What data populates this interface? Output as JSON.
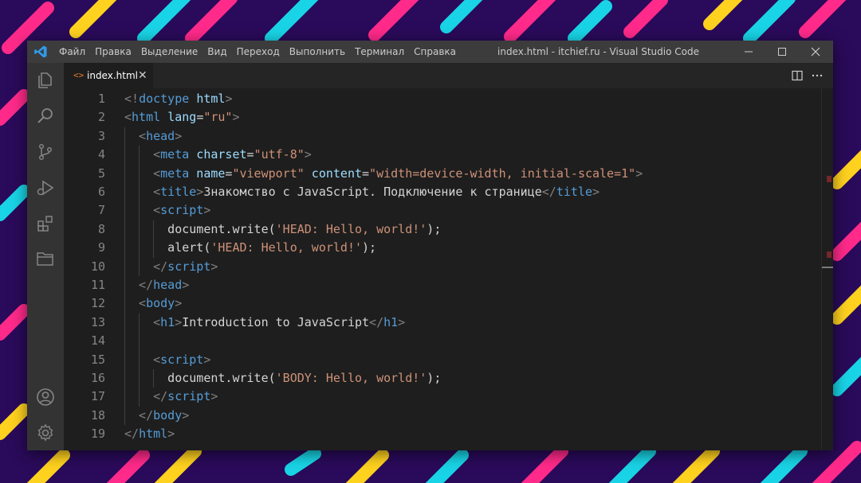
{
  "window": {
    "title": "index.html - itchief.ru - Visual Studio Code",
    "menu": [
      "Файл",
      "Правка",
      "Выделение",
      "Вид",
      "Переход",
      "Выполнить",
      "Терминал",
      "Справка"
    ]
  },
  "activity_bar": [
    "files-icon",
    "search-icon",
    "source-control-icon",
    "run-debug-icon",
    "extensions-icon",
    "remote-explorer-icon",
    "account-icon",
    "settings-gear-icon"
  ],
  "tab": {
    "label": "index.html",
    "icon": "<>",
    "close": "✕"
  },
  "editor": {
    "line_numbers": [
      "1",
      "2",
      "3",
      "4",
      "5",
      "6",
      "7",
      "8",
      "9",
      "10",
      "11",
      "12",
      "13",
      "14",
      "15",
      "16",
      "17",
      "18",
      "19"
    ],
    "lines": [
      {
        "indent": 0,
        "tokens": [
          [
            "tg",
            "<!"
          ],
          [
            "tn",
            "doctype"
          ],
          [
            "tx",
            " "
          ],
          [
            "at",
            "html"
          ],
          [
            "tg",
            ">"
          ]
        ]
      },
      {
        "indent": 0,
        "tokens": [
          [
            "tg",
            "<"
          ],
          [
            "tn",
            "html"
          ],
          [
            "tx",
            " "
          ],
          [
            "at",
            "lang"
          ],
          [
            "tx",
            "="
          ],
          [
            "st",
            "\"ru\""
          ],
          [
            "tg",
            ">"
          ]
        ]
      },
      {
        "indent": 1,
        "tokens": [
          [
            "tg",
            "<"
          ],
          [
            "tn",
            "head"
          ],
          [
            "tg",
            ">"
          ]
        ]
      },
      {
        "indent": 2,
        "tokens": [
          [
            "tg",
            "<"
          ],
          [
            "tn",
            "meta"
          ],
          [
            "tx",
            " "
          ],
          [
            "at",
            "charset"
          ],
          [
            "tx",
            "="
          ],
          [
            "st",
            "\"utf-8\""
          ],
          [
            "tg",
            ">"
          ]
        ]
      },
      {
        "indent": 2,
        "tokens": [
          [
            "tg",
            "<"
          ],
          [
            "tn",
            "meta"
          ],
          [
            "tx",
            " "
          ],
          [
            "at",
            "name"
          ],
          [
            "tx",
            "="
          ],
          [
            "st",
            "\"viewport\""
          ],
          [
            "tx",
            " "
          ],
          [
            "at",
            "content"
          ],
          [
            "tx",
            "="
          ],
          [
            "st",
            "\"width=device-width, initial-scale=1\""
          ],
          [
            "tg",
            ">"
          ]
        ]
      },
      {
        "indent": 2,
        "tokens": [
          [
            "tg",
            "<"
          ],
          [
            "tn",
            "title"
          ],
          [
            "tg",
            ">"
          ],
          [
            "tx",
            "Знакомство с JavaScript. Подключение к странице"
          ],
          [
            "tg",
            "</"
          ],
          [
            "tn",
            "title"
          ],
          [
            "tg",
            ">"
          ]
        ]
      },
      {
        "indent": 2,
        "tokens": [
          [
            "tg",
            "<"
          ],
          [
            "tn",
            "script"
          ],
          [
            "tg",
            ">"
          ]
        ]
      },
      {
        "indent": 3,
        "tokens": [
          [
            "tx",
            "document.write("
          ],
          [
            "st",
            "'HEAD: Hello, world!'"
          ],
          [
            "tx",
            ");"
          ]
        ]
      },
      {
        "indent": 3,
        "tokens": [
          [
            "tx",
            "alert("
          ],
          [
            "st",
            "'HEAD: Hello, world!'"
          ],
          [
            "tx",
            ");"
          ]
        ]
      },
      {
        "indent": 2,
        "tokens": [
          [
            "tg",
            "</"
          ],
          [
            "tn",
            "script"
          ],
          [
            "tg",
            ">"
          ]
        ]
      },
      {
        "indent": 1,
        "tokens": [
          [
            "tg",
            "</"
          ],
          [
            "tn",
            "head"
          ],
          [
            "tg",
            ">"
          ]
        ]
      },
      {
        "indent": 1,
        "tokens": [
          [
            "tg",
            "<"
          ],
          [
            "tn",
            "body"
          ],
          [
            "tg",
            ">"
          ]
        ]
      },
      {
        "indent": 2,
        "tokens": [
          [
            "tg",
            "<"
          ],
          [
            "tn",
            "h1"
          ],
          [
            "tg",
            ">"
          ],
          [
            "tx",
            "Introduction to JavaScript"
          ],
          [
            "tg",
            "</"
          ],
          [
            "tn",
            "h1"
          ],
          [
            "tg",
            ">"
          ]
        ]
      },
      {
        "indent": 0,
        "tokens": []
      },
      {
        "indent": 2,
        "tokens": [
          [
            "tg",
            "<"
          ],
          [
            "tn",
            "script"
          ],
          [
            "tg",
            ">"
          ]
        ]
      },
      {
        "indent": 3,
        "tokens": [
          [
            "tx",
            "document.write("
          ],
          [
            "st",
            "'BODY: Hello, world!'"
          ],
          [
            "tx",
            ");"
          ]
        ]
      },
      {
        "indent": 2,
        "tokens": [
          [
            "tg",
            "</"
          ],
          [
            "tn",
            "script"
          ],
          [
            "tg",
            ">"
          ]
        ]
      },
      {
        "indent": 1,
        "tokens": [
          [
            "tg",
            "</"
          ],
          [
            "tn",
            "body"
          ],
          [
            "tg",
            ">"
          ]
        ]
      },
      {
        "indent": 0,
        "tokens": [
          [
            "tg",
            "</"
          ],
          [
            "tn",
            "html"
          ],
          [
            "tg",
            ">"
          ]
        ]
      }
    ]
  },
  "colors": {
    "background": "#2a0a5a",
    "stripes": [
      "#ff2a8a",
      "#19d4e6",
      "#ffd21f"
    ],
    "tag_name": "#569cd6",
    "attribute": "#9cdcfe",
    "string": "#ce9178"
  }
}
